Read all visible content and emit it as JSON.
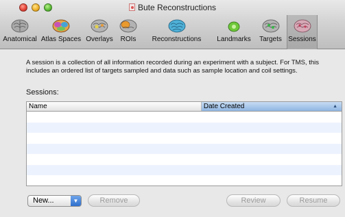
{
  "window": {
    "title": "Bute Reconstructions"
  },
  "toolbar": {
    "items": [
      {
        "label": "Anatomical",
        "icon": "brain-gray-icon"
      },
      {
        "label": "Atlas Spaces",
        "icon": "brain-color-icon"
      },
      {
        "label": "Overlays",
        "icon": "brain-overlay-icon"
      },
      {
        "label": "ROIs",
        "icon": "brain-roi-icon"
      },
      {
        "label": "Reconstructions",
        "icon": "brain-blue-icon"
      },
      {
        "label": "Landmarks",
        "icon": "landmark-green-icon"
      },
      {
        "label": "Targets",
        "icon": "brain-targets-icon"
      },
      {
        "label": "Sessions",
        "icon": "brain-sessions-icon"
      }
    ],
    "selected": "Sessions"
  },
  "main": {
    "description": "A session is a collection of all information recorded during an experiment with a subject. For TMS, this includes an ordered list of targets sampled and data such as sample location and coil settings.",
    "sessions_label": "Sessions:",
    "table": {
      "columns": [
        "Name",
        "Date Created"
      ],
      "sorted_column": "Date Created",
      "sort_indicator": "▲",
      "rows": []
    }
  },
  "buttons": {
    "new_label": "New...",
    "new_arrow": "▼",
    "remove_label": "Remove",
    "review_label": "Review",
    "resume_label": "Resume"
  },
  "colors": {
    "selected_header": "#8fb6e3",
    "alt_row": "#edf3fe",
    "popup_arrow": "#2f6fcd"
  }
}
